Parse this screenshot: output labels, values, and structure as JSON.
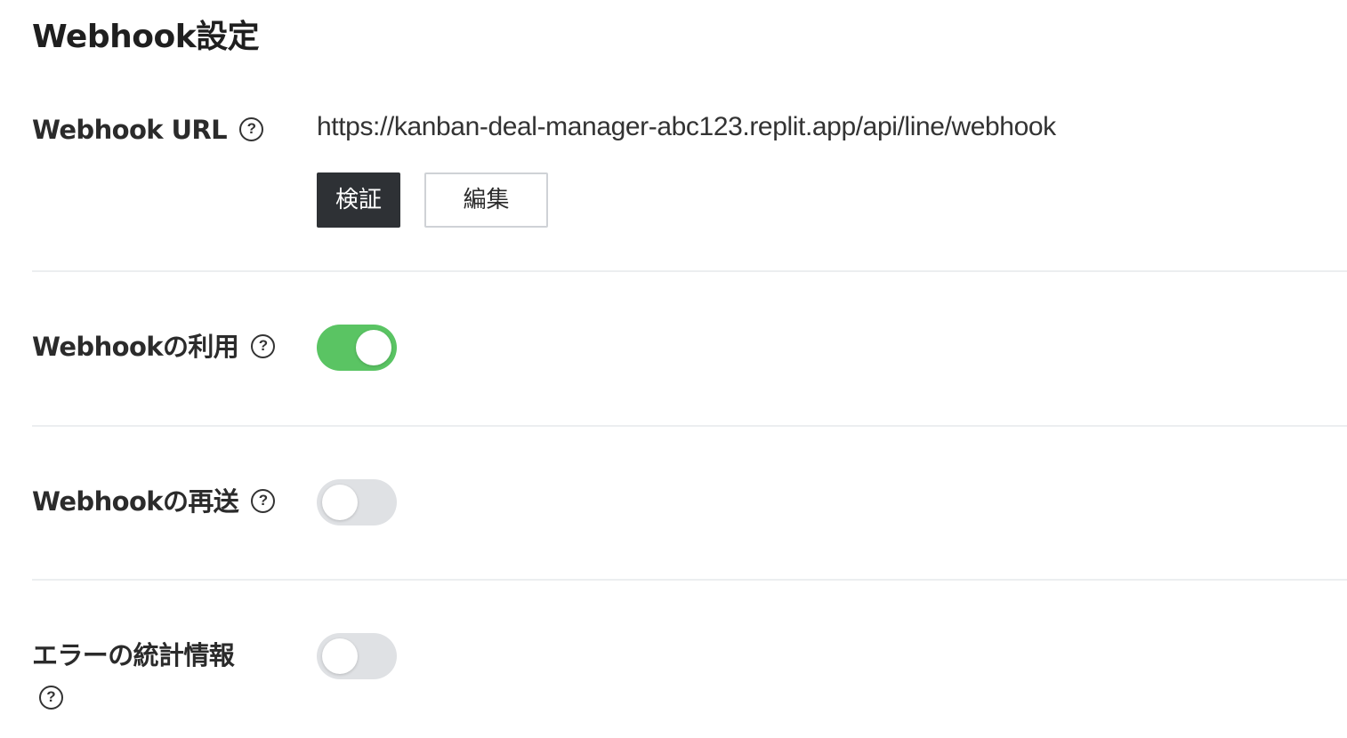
{
  "title": "Webhook設定",
  "webhook_url": {
    "label": "Webhook URL",
    "value": "https://kanban-deal-manager-abc123.replit.app/api/line/webhook",
    "verify_label": "検証",
    "edit_label": "編集"
  },
  "use_webhook": {
    "label": "Webhookの利用",
    "enabled": true
  },
  "redelivery": {
    "label": "Webhookの再送",
    "enabled": false
  },
  "error_stats": {
    "label": "エラーの統計情報",
    "enabled": false
  },
  "help_glyph": "?",
  "icons": {
    "help": "question-circle-icon"
  },
  "colors": {
    "toggle_on": "#5ac463",
    "toggle_off": "#dfe1e4",
    "primary_button": "#2e3135"
  }
}
